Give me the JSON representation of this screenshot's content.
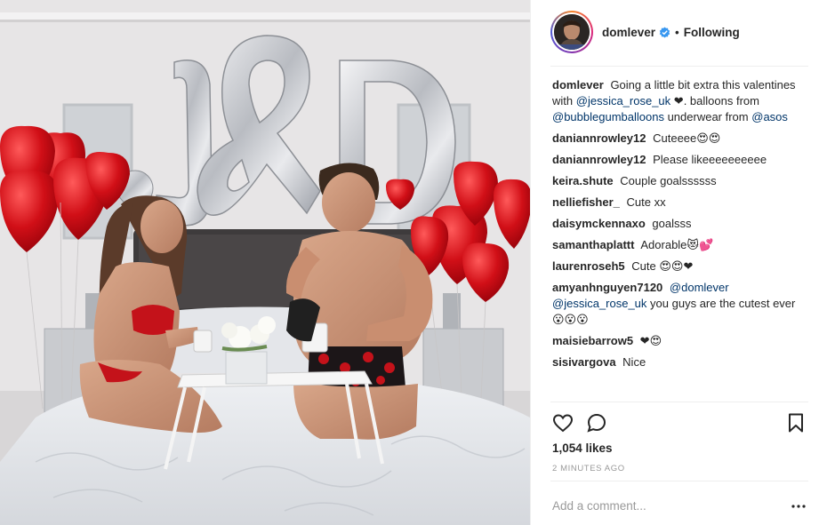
{
  "photo": {
    "description_icon": "post-photo",
    "balloon_letters": [
      "J",
      "&",
      "D"
    ]
  },
  "header": {
    "username": "domlever",
    "separator": "•",
    "follow_state": "Following",
    "verified_icon": "verified-badge-icon"
  },
  "caption": {
    "username": "domlever",
    "text_1": "Going a little bit extra this valentines with",
    "mention_1": "@jessica_rose_uk",
    "text_2": "❤. balloons from",
    "mention_2": "@bubblegumballoons",
    "text_3": "underwear from",
    "mention_3": "@asos"
  },
  "comments": [
    {
      "username": "daniannrowley12",
      "text": "Cuteeee😍😍"
    },
    {
      "username": "daniannrowley12",
      "text": "Please likeeeeeeeeee"
    },
    {
      "username": "keira.shute",
      "text": "Couple goalssssss"
    },
    {
      "username": "nelliefisher_",
      "text": "Cute xx"
    },
    {
      "username": "daisymckennaxo",
      "text": "goalsss"
    },
    {
      "username": "samanthaplattt",
      "text": "Adorable😻💕"
    },
    {
      "username": "laurenroseh5",
      "text": "Cute 😍😍❤"
    },
    {
      "username": "amyanhnguyen7120",
      "mention": "@domlever",
      "mention_2": "@jessica_rose_uk",
      "text": "you guys are the cutest ever 😮😮😮"
    },
    {
      "username": "maisiebarrow5",
      "text": "❤😍"
    },
    {
      "username": "sisivargova",
      "text": "Nice"
    }
  ],
  "actions": {
    "like_icon": "heart-icon",
    "comment_icon": "comment-icon",
    "save_icon": "bookmark-icon"
  },
  "likes": "1,054 likes",
  "timestamp": "2 MINUTES AGO",
  "add_comment": {
    "placeholder": "Add a comment...",
    "more_icon": "more-options-icon",
    "more_label": "•••"
  },
  "colors": {
    "link": "#003569",
    "verified": "#3897f0",
    "divider": "#efefef",
    "muted": "#999999"
  }
}
